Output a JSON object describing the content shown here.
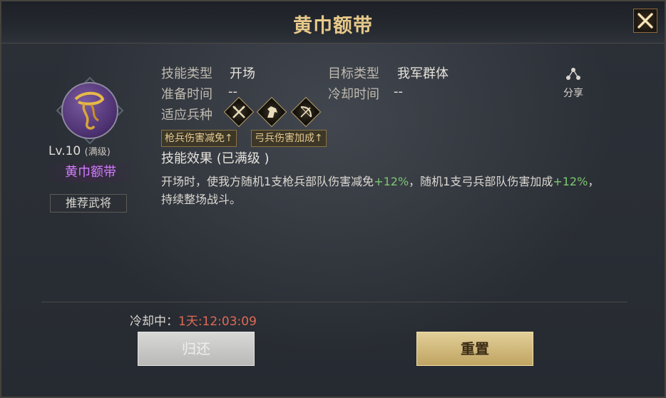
{
  "window": {
    "title": "黄巾额带"
  },
  "skill": {
    "level": "Lv.10",
    "level_note": "(满级)",
    "name": "黄巾额带",
    "recommend_label": "推荐武将"
  },
  "info": {
    "type_label": "技能类型",
    "type_value": "开场",
    "target_label": "目标类型",
    "target_value": "我军群体",
    "prep_label": "准备时间",
    "prep_value": "--",
    "cooldown_label": "冷却时间",
    "cooldown_value": "--",
    "troops_label": "适应兵种",
    "troops": [
      "spear-icon",
      "cavalry-icon",
      "archer-icon"
    ],
    "tags": [
      "枪兵伤害减免↑",
      "弓兵伤害加成↑"
    ]
  },
  "effect": {
    "title": "技能效果 (已满级 )",
    "desc_1": "开场时，使我方随机1支枪兵部队伤害减免",
    "value_1": "+12%",
    "desc_2": "，随机1支弓兵部队伤害加成",
    "value_2": "+12%",
    "desc_3": "，持续整场战斗。"
  },
  "share_label": "分享",
  "status": {
    "cooldown_label": "冷却中：",
    "cooldown_time": "1天:12:03:09"
  },
  "buttons": {
    "return_label": "归还",
    "reset_label": "重置"
  },
  "colors": {
    "title_gold": "#e7c98a",
    "skill_name_purple": "#d27dff",
    "bonus_green": "#7cc86f",
    "timer_red": "#e06a55"
  }
}
